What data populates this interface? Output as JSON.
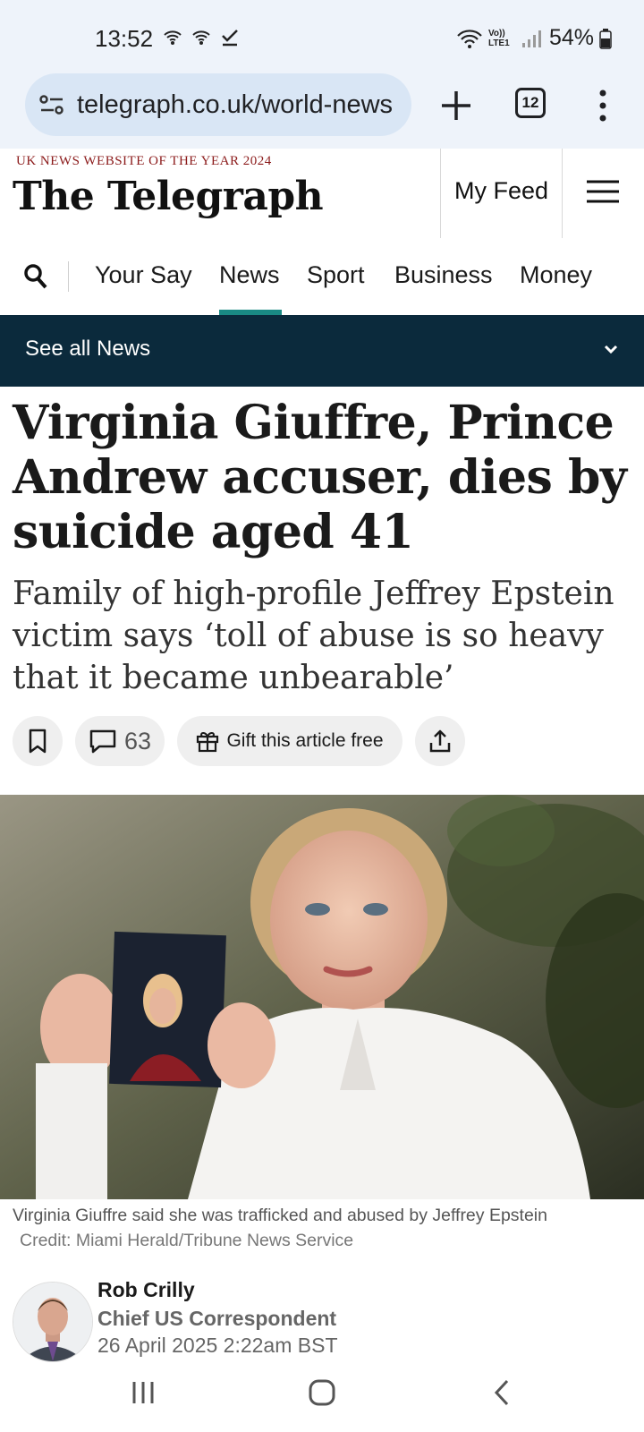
{
  "status_bar": {
    "time": "13:52",
    "battery": "54%",
    "network_label": "Vo)) LTE1"
  },
  "browser": {
    "url": "telegraph.co.uk/world-news",
    "tab_count": "12"
  },
  "header": {
    "award": "UK NEWS WEBSITE OF THE YEAR 2024",
    "logo": "The Telegraph",
    "my_feed": "My Feed"
  },
  "nav": {
    "items": [
      "Your Say",
      "News",
      "Sport",
      "Business",
      "Money"
    ],
    "active": "News"
  },
  "see_all": {
    "label": "See all News"
  },
  "article": {
    "headline": "Virginia Giuffre, Prince Andrew accuser, dies by suicide aged 41",
    "standfirst": "Family of high-profile Jeffrey Epstein victim says ‘toll of abuse is so heavy that it became unbearable’",
    "comment_count": "63",
    "gift_label": "Gift this article free",
    "caption": "Virginia Giuffre said she was trafficked and abused by Jeffrey Epstein",
    "credit": "Credit: Miami Herald/Tribune News Service"
  },
  "author": {
    "name": "Rob Crilly",
    "role": "Chief US Correspondent",
    "date": "26 April 2025 2:22am BST"
  },
  "colors": {
    "accent_teal": "#1a8a84",
    "see_all_bg": "#0b2a3c",
    "browser_bg": "#eef3fa"
  }
}
